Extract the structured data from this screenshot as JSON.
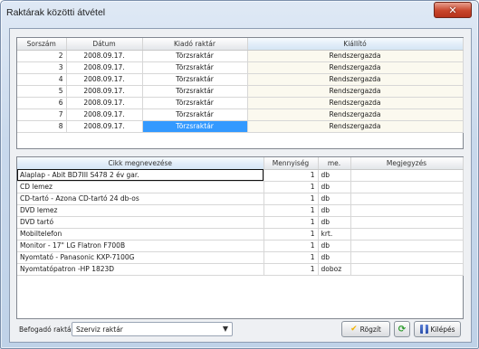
{
  "window": {
    "title": "Raktárak közötti átvétel",
    "close_label": "✕"
  },
  "transfers": {
    "columns": [
      "Sorszám",
      "Dátum",
      "Kiadó raktár",
      "Kiállító"
    ],
    "rows": [
      [
        "2",
        "2008.09.17.",
        "Törzsraktár",
        "Rendszergazda"
      ],
      [
        "3",
        "2008.09.17.",
        "Törzsraktár",
        "Rendszergazda"
      ],
      [
        "4",
        "2008.09.17.",
        "Törzsraktár",
        "Rendszergazda"
      ],
      [
        "5",
        "2008.09.17.",
        "Törzsraktár",
        "Rendszergazda"
      ],
      [
        "6",
        "2008.09.17.",
        "Törzsraktár",
        "Rendszergazda"
      ],
      [
        "7",
        "2008.09.17.",
        "Törzsraktár",
        "Rendszergazda"
      ],
      [
        "8",
        "2008.09.17.",
        "Törzsraktár",
        "Rendszergazda"
      ]
    ]
  },
  "items": {
    "columns": [
      "Cikk megnevezése",
      "Mennyiség",
      "me.",
      "Megjegyzés"
    ],
    "rows": [
      [
        "Alaplap - Abit BD7III  S478  2 év gar.",
        "1",
        "db",
        ""
      ],
      [
        "CD lemez",
        "1",
        "db",
        ""
      ],
      [
        "CD-tartó - Azona CD-tartó 24 db-os",
        "1",
        "db",
        ""
      ],
      [
        "DVD lemez",
        "1",
        "db",
        ""
      ],
      [
        "DVD tartó",
        "1",
        "db",
        ""
      ],
      [
        "Mobiltelefon",
        "1",
        "krt.",
        ""
      ],
      [
        "Monitor - 17\" LG Flatron F700B",
        "1",
        "db",
        ""
      ],
      [
        "Nyomtató - Panasonic KXP-7100G",
        "1",
        "db",
        ""
      ],
      [
        "Nyomtatópatron -HP 1823D",
        "1",
        "doboz",
        ""
      ]
    ]
  },
  "footer": {
    "receiving_label": "Befogadó raktár:",
    "receiving_value": "Szerviz raktár",
    "dropdown_arrow": "▼",
    "save_label": "Rögzít",
    "exit_label": "Kilépés",
    "save_icon": "check-icon",
    "refresh_icon": "refresh-icon",
    "exit_icon": "door-exit-icon"
  },
  "colors": {
    "selection": "#3399ff",
    "window_bg": "#c9d9ec",
    "close_button": "#c8452b"
  }
}
